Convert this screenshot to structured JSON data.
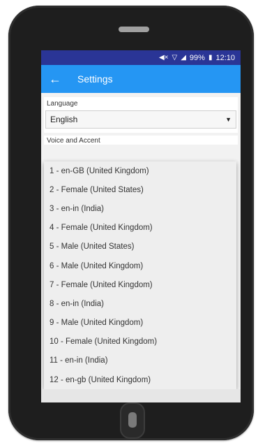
{
  "status_bar": {
    "battery": "99%",
    "time": "12:10",
    "icons": [
      "mute-icon",
      "wifi-icon",
      "signal-icon",
      "battery-icon"
    ]
  },
  "app_bar": {
    "title": "Settings",
    "back_icon": "arrow-left-icon",
    "color": "#2596f3"
  },
  "language": {
    "label": "Language",
    "value": "English"
  },
  "voice": {
    "label": "Voice and Accent",
    "options": [
      "1 - en-GB (United Kingdom)",
      "2 - Female (United States)",
      "3 - en-in (India)",
      "4 - Female (United Kingdom)",
      "5 - Male (United States)",
      "6 - Male (United Kingdom)",
      "7 - Female (United Kingdom)",
      "8 - en-in (India)",
      "9 - Male (United Kingdom)",
      "10 - Female (United Kingdom)",
      "11 - en-in (India)",
      "12 - en-gb (United Kingdom)"
    ]
  }
}
